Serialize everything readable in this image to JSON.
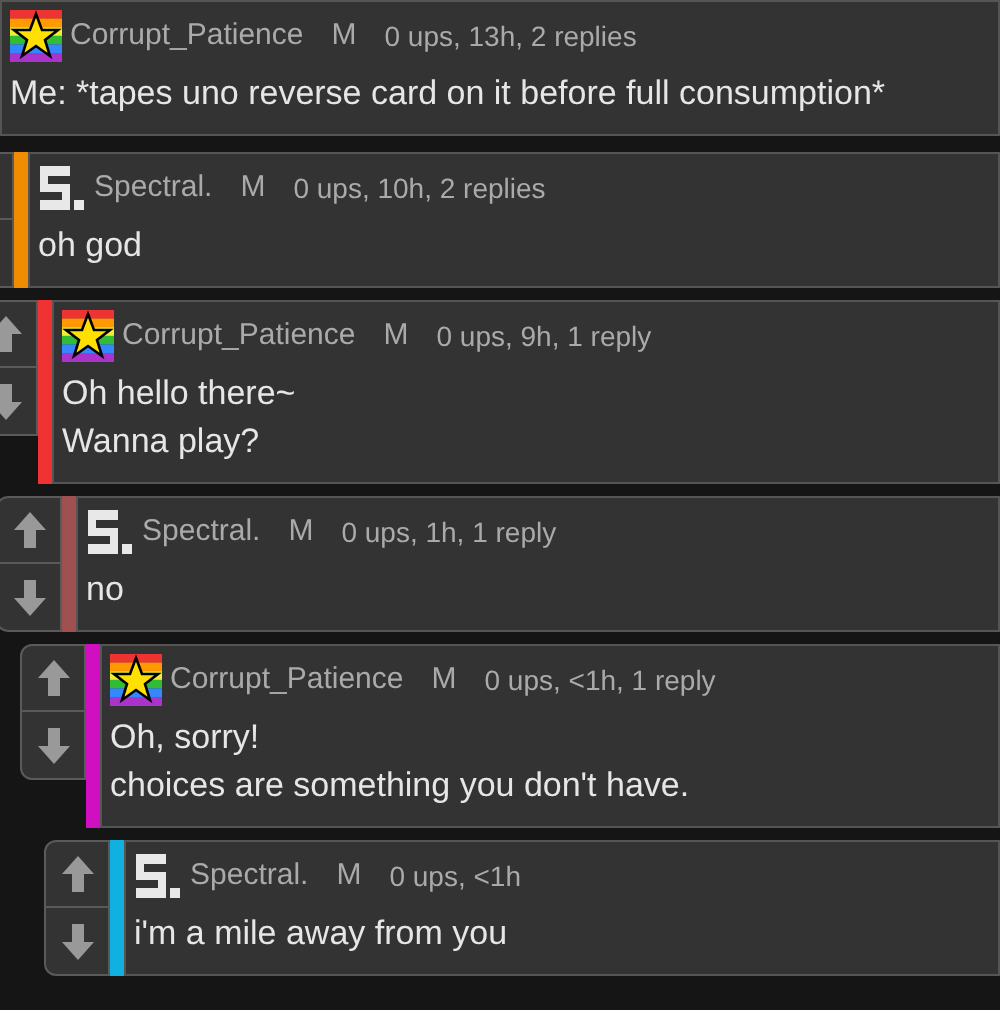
{
  "comment": {
    "kind": "star",
    "username": "Corrupt_Patience",
    "badge": "M",
    "meta": "0 ups, 13h, 2 replies",
    "text": "Me: *tapes uno reverse card on it before full consumption*",
    "children": [
      {
        "kind": "block",
        "username": "Spectral.",
        "badge": "M",
        "meta": "0 ups, 10h, 2 replies",
        "text": "oh god",
        "color": "#f08c00",
        "children": [
          {
            "kind": "star",
            "username": "Corrupt_Patience",
            "badge": "M",
            "meta": "0 ups, 9h, 1 reply",
            "text": "Oh hello there~\nWanna play?",
            "color": "#f03232",
            "children": [
              {
                "kind": "block",
                "username": "Spectral.",
                "badge": "M",
                "meta": "0 ups, 1h, 1 reply",
                "text": "no",
                "color": "#a05050",
                "children": [
                  {
                    "kind": "star",
                    "username": "Corrupt_Patience",
                    "badge": "M",
                    "meta": "0 ups, <1h, 1 reply",
                    "text": "Oh, sorry!\nchoices are something you don't have.",
                    "color": "#d010c0",
                    "children": [
                      {
                        "kind": "block",
                        "username": "Spectral.",
                        "badge": "M",
                        "meta": "0 ups, <1h",
                        "text": "i'm a mile away from you",
                        "color": "#10b0e0"
                      }
                    ]
                  }
                ]
              }
            ]
          }
        ]
      }
    ]
  }
}
